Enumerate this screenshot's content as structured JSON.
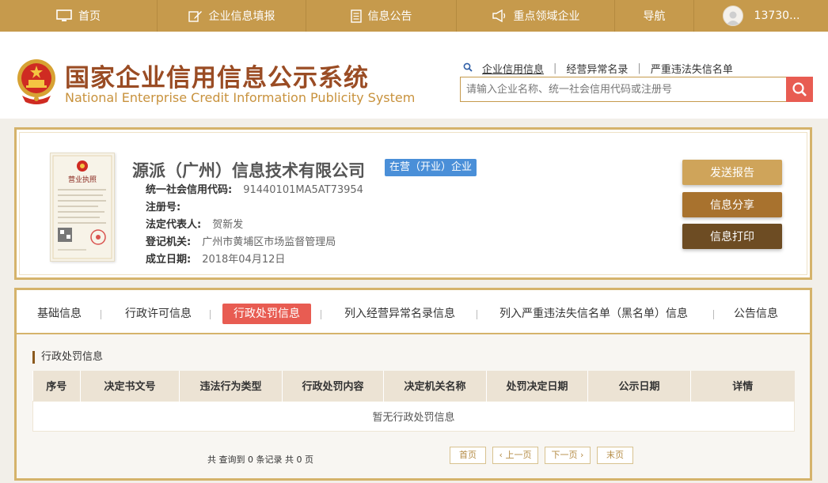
{
  "nav": {
    "items": [
      {
        "label": "首页",
        "icon": "monitor-icon"
      },
      {
        "label": "企业信息填报",
        "icon": "edit-icon"
      },
      {
        "label": "信息公告",
        "icon": "document-icon"
      },
      {
        "label": "重点领域企业",
        "icon": "megaphone-icon"
      },
      {
        "label": "导航",
        "icon": ""
      }
    ],
    "user": "13730..."
  },
  "header": {
    "title": "国家企业信用信息公示系统",
    "subtitle": "National Enterprise Credit Information Publicity System",
    "search_tabs": [
      "企业信用信息",
      "经营异常名录",
      "严重违法失信名单"
    ],
    "search_placeholder": "请输入企业名称、统一社会信用代码或注册号"
  },
  "company": {
    "name": "源派（广州）信息技术有限公司",
    "status": "在营（开业）企业",
    "fields": [
      {
        "label": "统一社会信用代码:",
        "value": "91440101MA5AT73954"
      },
      {
        "label": "注册号:",
        "value": ""
      },
      {
        "label": "法定代表人:",
        "value": "贺新发"
      },
      {
        "label": "登记机关:",
        "value": "广州市黄埔区市场监督管理局"
      },
      {
        "label": "成立日期:",
        "value": "2018年04月12日"
      }
    ],
    "license_title": "营业执照",
    "actions": [
      "发送报告",
      "信息分享",
      "信息打印"
    ]
  },
  "detail": {
    "tabs": [
      "基础信息",
      "行政许可信息",
      "行政处罚信息",
      "列入经营异常名录信息",
      "列入严重违法失信名单（黑名单）信息",
      "公告信息"
    ],
    "active_tab": 2,
    "section_title": "行政处罚信息",
    "columns": [
      "序号",
      "决定书文号",
      "违法行为类型",
      "行政处罚内容",
      "决定机关名称",
      "处罚决定日期",
      "公示日期",
      "详情"
    ],
    "empty_text": "暂无行政处罚信息",
    "pagination": {
      "summary": "共 查询到 0 条记录 共 0 页",
      "first": "首页",
      "prev": "‹ 上一页",
      "next": "下一页 ›",
      "last": "末页"
    }
  },
  "colors": {
    "nav_bg": "#c69a4c",
    "title": "#9a4c24",
    "accent_red": "#e85c52",
    "badge_blue": "#4a8fd8",
    "border_gold": "#d5b36b"
  }
}
